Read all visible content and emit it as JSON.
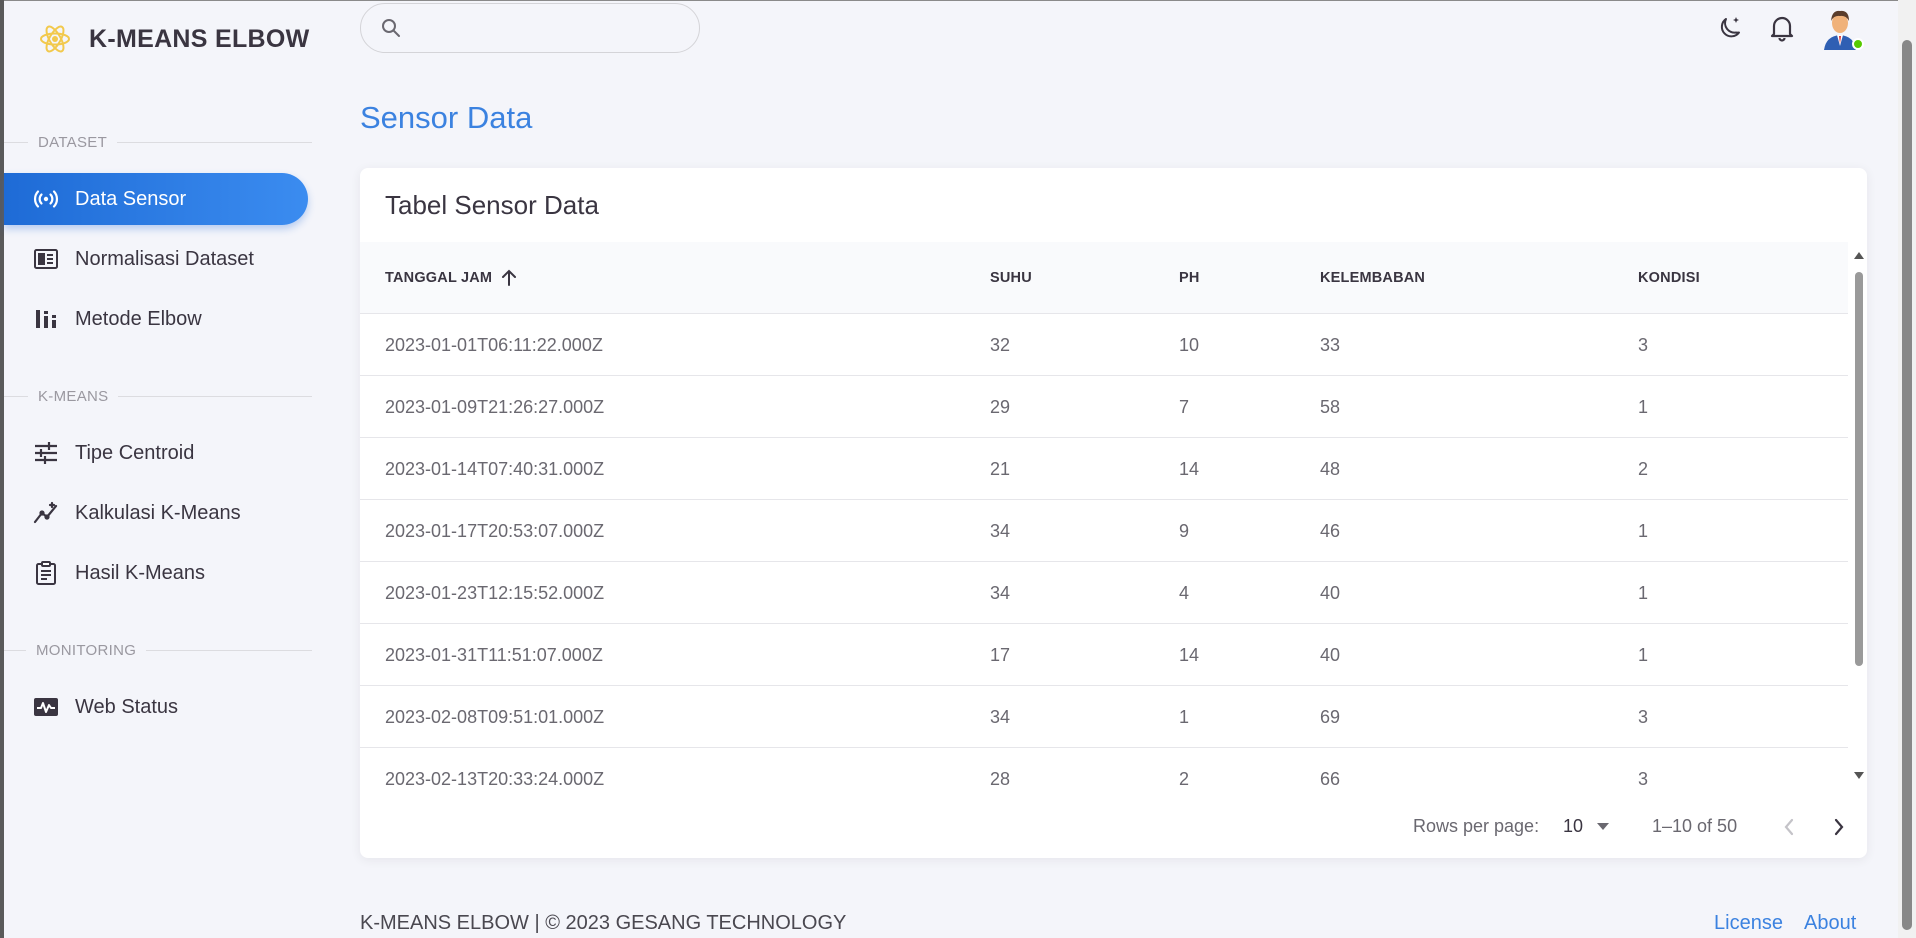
{
  "brand": {
    "name": "K-MEANS ELBOW",
    "logo_icon": "atom-logo-icon",
    "logo_color": "#f2c94c"
  },
  "sidebar": {
    "sections": [
      {
        "label": "DATASET",
        "items": [
          {
            "label": "Data Sensor",
            "icon": "broadcast-icon",
            "active": true
          },
          {
            "label": "Normalisasi Dataset",
            "icon": "table-icon"
          },
          {
            "label": "Metode Elbow",
            "icon": "bar-chart-icon"
          }
        ]
      },
      {
        "label": "K-MEANS",
        "items": [
          {
            "label": "Tipe Centroid",
            "icon": "sliders-icon"
          },
          {
            "label": "Kalkulasi K-Means",
            "icon": "line-chart-icon"
          },
          {
            "label": "Hasil K-Means",
            "icon": "clipboard-icon"
          }
        ]
      },
      {
        "label": "MONITORING",
        "items": [
          {
            "label": "Web Status",
            "icon": "pulse-icon"
          }
        ]
      }
    ]
  },
  "header": {
    "search": {
      "placeholder": "",
      "value": ""
    },
    "icons": [
      "theme-moon-icon",
      "bell-icon",
      "user-avatar"
    ]
  },
  "page": {
    "title": "Sensor Data"
  },
  "table": {
    "title": "Tabel Sensor Data",
    "columns": [
      "TANGGAL JAM",
      "SUHU",
      "PH",
      "KELEMBABAN",
      "KONDISI"
    ],
    "sort": {
      "column": "TANGGAL JAM",
      "direction": "asc"
    },
    "rows": [
      [
        "2023-01-01T06:11:22.000Z",
        "32",
        "10",
        "33",
        "3"
      ],
      [
        "2023-01-09T21:26:27.000Z",
        "29",
        "7",
        "58",
        "1"
      ],
      [
        "2023-01-14T07:40:31.000Z",
        "21",
        "14",
        "48",
        "2"
      ],
      [
        "2023-01-17T20:53:07.000Z",
        "34",
        "9",
        "46",
        "1"
      ],
      [
        "2023-01-23T12:15:52.000Z",
        "34",
        "4",
        "40",
        "1"
      ],
      [
        "2023-01-31T11:51:07.000Z",
        "17",
        "14",
        "40",
        "1"
      ],
      [
        "2023-02-08T09:51:01.000Z",
        "34",
        "1",
        "69",
        "3"
      ],
      [
        "2023-02-13T20:33:24.000Z",
        "28",
        "2",
        "66",
        "3"
      ]
    ]
  },
  "pagination": {
    "rows_per_page_label": "Rows per page:",
    "rows_per_page": "10",
    "range": "1–10 of 50"
  },
  "footer": {
    "text": "K-MEANS ELBOW | © 2023 GESANG TECHNOLOGY",
    "links": [
      "License",
      "About"
    ]
  },
  "colors": {
    "accent": "#3b82e0",
    "active_nav_start": "#1e6bd6",
    "active_nav_end": "#3b8cf0",
    "online": "#56ca00"
  }
}
